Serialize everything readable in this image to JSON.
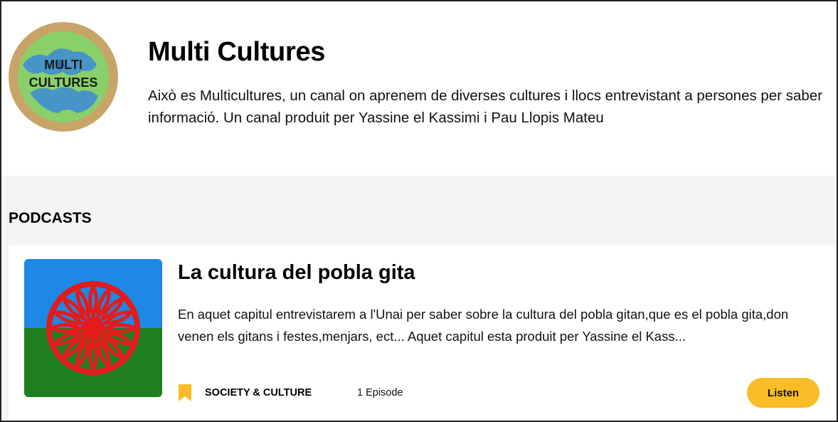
{
  "channel": {
    "logo_text_line1": "MULTI",
    "logo_text_line2": "CULTURES",
    "title": "Multi Cultures",
    "description": "Això es Multicultures, un canal on aprenem de diverses cultures i llocs entrevistant a persones per saber informació. Un canal produit per Yassine el Kassimi i Pau Llopis Mateu"
  },
  "podcasts_section": {
    "heading": "PODCASTS",
    "items": [
      {
        "title": "La cultura del pobla gita",
        "description": "En aquet capitul entrevistarem a l'Unai per saber sobre la cultura del pobla gitan,que es el pobla gita,don venen els gitans i festes,menjars, ect... Aquet capitul esta produit per Yassine el Kass...",
        "category": "SOCIETY & CULTURE",
        "episodes": "1 Episode",
        "listen_label": "Listen",
        "cover_icon": "romani-flag"
      }
    ]
  },
  "colors": {
    "accent_button": "#fbbd25",
    "bookmark": "#fbbd25",
    "section_background": "#f4f4f4",
    "flag_blue": "#1e88e5",
    "flag_green": "#1d7f1d",
    "flag_red": "#e31b1b"
  }
}
